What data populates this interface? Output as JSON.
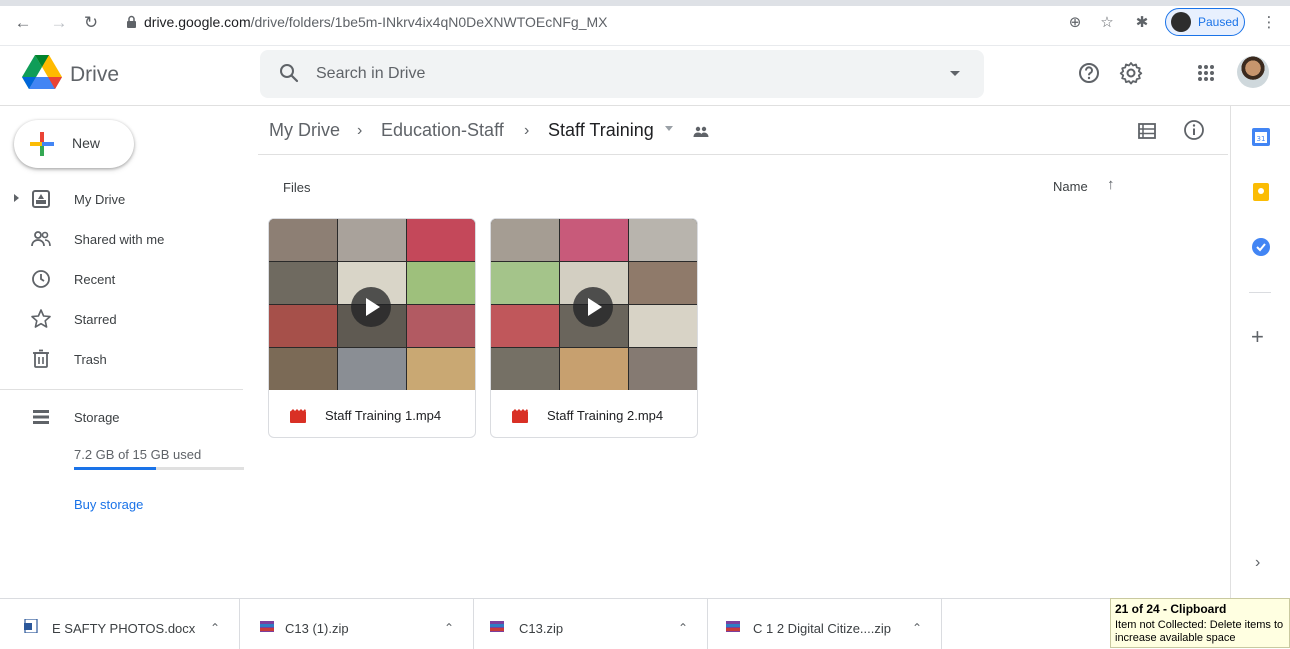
{
  "browser": {
    "url_host": "drive.google.com",
    "url_path": "/drive/folders/1be5m-INkrv4ix4qN0DeXNWTOEcNFg_MX",
    "profile_label": "Paused"
  },
  "header": {
    "brand": "Drive",
    "search_placeholder": "Search in Drive"
  },
  "sidebar": {
    "new_label": "New",
    "items": [
      {
        "label": "My Drive",
        "icon": "my-drive-icon"
      },
      {
        "label": "Shared with me",
        "icon": "people-icon"
      },
      {
        "label": "Recent",
        "icon": "clock-icon"
      },
      {
        "label": "Starred",
        "icon": "star-icon"
      },
      {
        "label": "Trash",
        "icon": "trash-icon"
      }
    ],
    "storage_label": "Storage",
    "storage_text": "7.2 GB of 15 GB used",
    "storage_used_fraction": 0.48,
    "buy_storage": "Buy storage"
  },
  "main": {
    "breadcrumb": [
      "My Drive",
      "Education-Staff",
      "Staff Training"
    ],
    "files_label": "Files",
    "sort_label": "Name",
    "files": [
      {
        "name": "Staff Training 1.mp4"
      },
      {
        "name": "Staff Training 2.mp4"
      }
    ]
  },
  "downloads": [
    {
      "name": "E SAFTY PHOTOS.docx"
    },
    {
      "name": "C13 (1).zip"
    },
    {
      "name": "C13.zip"
    },
    {
      "name": "C 1 2 Digital Citize....zip"
    }
  ],
  "clipboard": {
    "title": "21 of 24 - Clipboard",
    "message": "Item not Collected: Delete items to increase available space"
  },
  "colors": {
    "accent": "#1a73e8",
    "video_icon": "#d93025"
  }
}
